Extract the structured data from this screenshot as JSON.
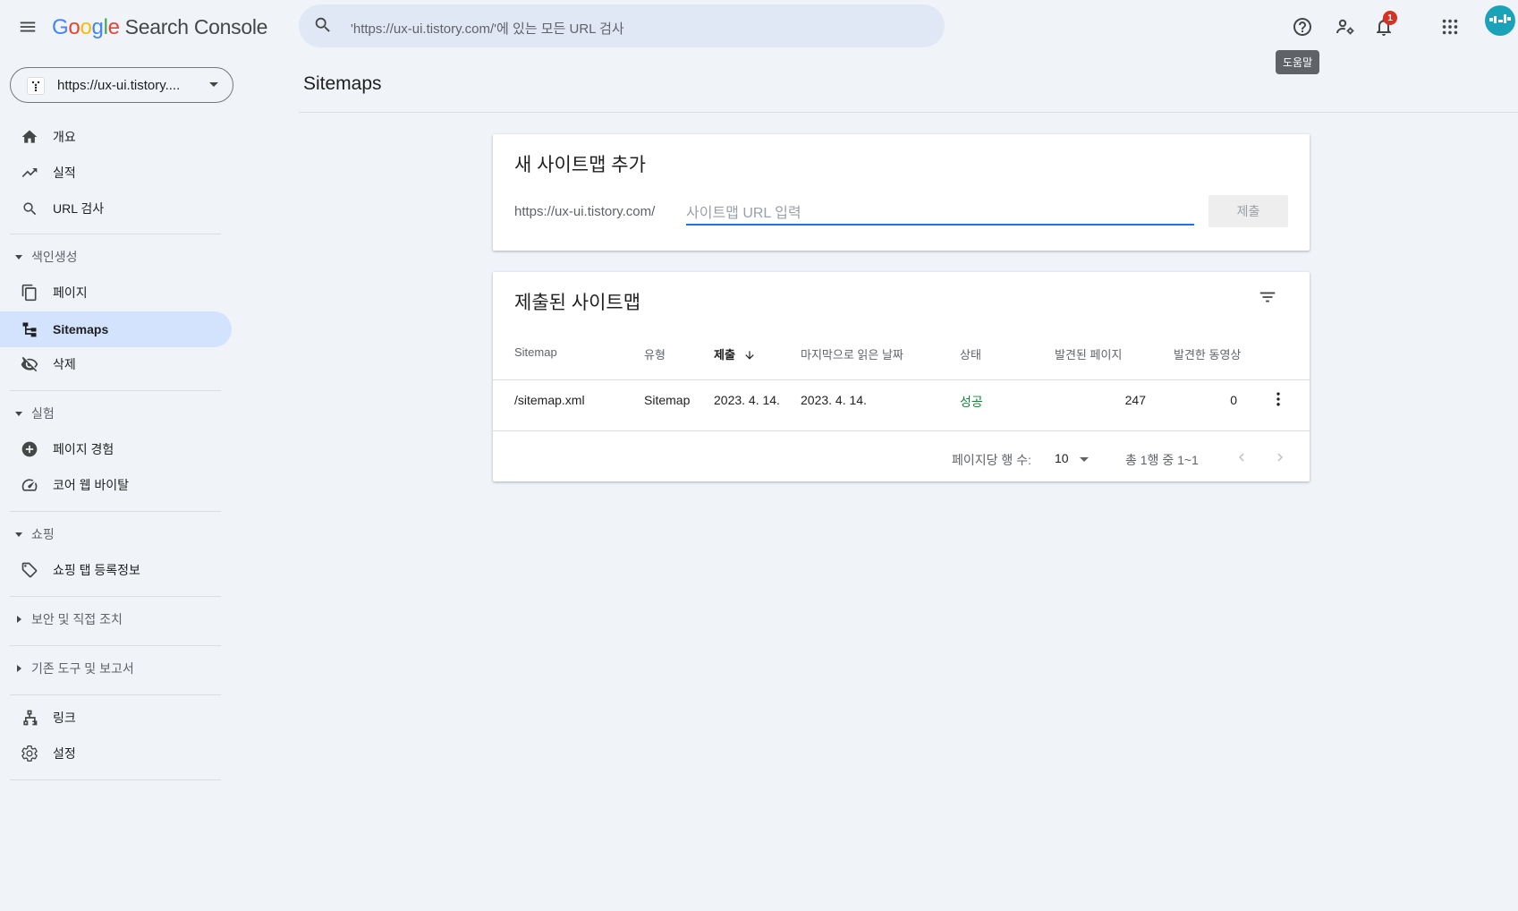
{
  "header": {
    "logo_google": [
      "G",
      "o",
      "o",
      "g",
      "l",
      "e"
    ],
    "logo_colors": [
      "#4285F4",
      "#EA4335",
      "#FBBC05",
      "#4285F4",
      "#34A853",
      "#EA4335"
    ],
    "logo_product": "Search Console",
    "search_placeholder": "'https://ux-ui.tistory.com/'에 있는 모든 URL 검사",
    "notification_count": "1",
    "tooltip": "도움말",
    "icons": [
      "menu-icon",
      "search-icon",
      "help-icon",
      "manage-users-icon",
      "notifications-icon",
      "apps-grid-icon",
      "avatar"
    ]
  },
  "sidebar": {
    "property": "https://ux-ui.tistory....",
    "items_top": [
      {
        "label": "개요",
        "icon": "home-icon"
      },
      {
        "label": "실적",
        "icon": "trending-up-icon"
      },
      {
        "label": "URL 검사",
        "icon": "search-icon"
      }
    ],
    "sections": [
      {
        "label": "색인생성",
        "expanded": true,
        "items": [
          {
            "label": "페이지",
            "icon": "pages-icon"
          },
          {
            "label": "Sitemaps",
            "icon": "sitemap-icon",
            "active": true
          },
          {
            "label": "삭제",
            "icon": "visibility-off-icon"
          }
        ]
      },
      {
        "label": "실험",
        "expanded": true,
        "items": [
          {
            "label": "페이지 경험",
            "icon": "add-circle-icon"
          },
          {
            "label": "코어 웹 바이탈",
            "icon": "speed-gauge-icon"
          }
        ]
      },
      {
        "label": "쇼핑",
        "expanded": true,
        "items": [
          {
            "label": "쇼핑 탭 등록정보",
            "icon": "tag-icon"
          }
        ]
      },
      {
        "label": "보안 및 직접 조치",
        "expanded": false
      },
      {
        "label": "기존 도구 및 보고서",
        "expanded": false
      }
    ],
    "items_bottom": [
      {
        "label": "링크",
        "icon": "links-icon"
      },
      {
        "label": "설정",
        "icon": "settings-gear-icon"
      }
    ]
  },
  "main": {
    "title": "Sitemaps",
    "add_card": {
      "title": "새 사이트맵 추가",
      "prefix": "https://ux-ui.tistory.com/",
      "input_placeholder": "사이트맵 URL 입력",
      "input_value": "",
      "submit_label": "제출"
    },
    "list_card": {
      "title": "제출된 사이트맵",
      "columns": [
        "Sitemap",
        "유형",
        "제출",
        "마지막으로 읽은 날짜",
        "상태",
        "발견된 페이지",
        "발견한 동영상"
      ],
      "sorted_column": "제출",
      "sort_direction": "desc",
      "rows": [
        {
          "sitemap": "/sitemap.xml",
          "type": "Sitemap",
          "submitted": "2023. 4. 14.",
          "last_read": "2023. 4. 14.",
          "status": "성공",
          "pages": "247",
          "videos": "0"
        }
      ],
      "pagination": {
        "rows_per_page_label": "페이지당 행 수:",
        "rows_per_page": "10",
        "range": "총 1행 중 1~1"
      }
    },
    "colors": {
      "accent": "#1a73e8",
      "success": "#188038",
      "active_nav": "#d3e3fd",
      "background": "#f0f4f9"
    }
  }
}
